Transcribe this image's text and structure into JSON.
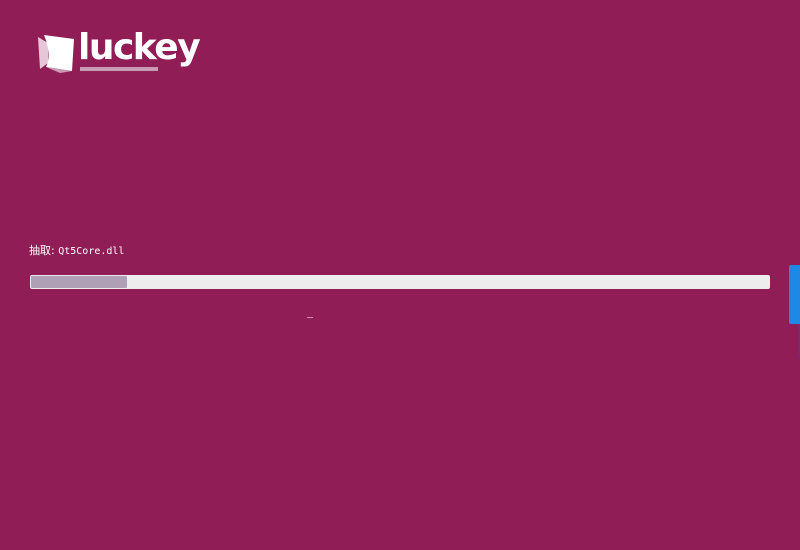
{
  "app": {
    "brand": "luckey",
    "background_color": "#901d56",
    "accent_color": "#1e88e5"
  },
  "status": {
    "label": "抽取:",
    "filename": "Qt5Core.dll"
  },
  "progress": {
    "fraction": 0.13
  },
  "icons": {
    "logo": "luckey-logo-icon",
    "side_tab": "side-panel-tab"
  }
}
